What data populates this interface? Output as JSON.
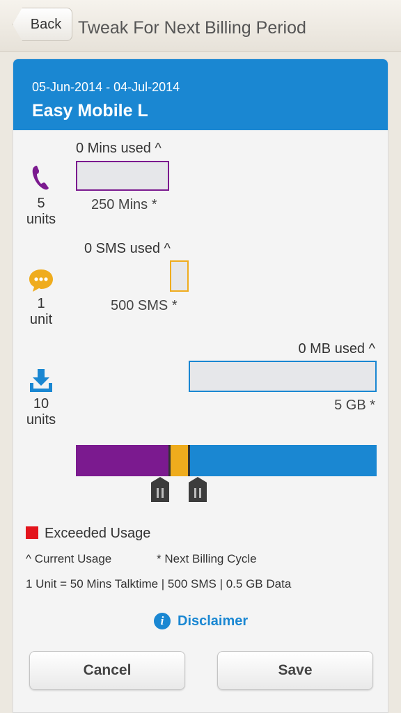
{
  "header": {
    "back_label": "Back",
    "title": "Tweak For Next Billing Period"
  },
  "plan": {
    "period": "05-Jun-2014 - 04-Jul-2014",
    "name": "Easy Mobile L"
  },
  "services": [
    {
      "icon": "phone-icon",
      "color": "#7b1a8f",
      "units_value": "5",
      "units_label": "units",
      "used": "0 Mins used ^",
      "limit": "250 Mins *"
    },
    {
      "icon": "chat-bubble-icon",
      "color": "#efac1d",
      "units_value": "1",
      "units_label": "unit",
      "used": "0 SMS used ^",
      "limit": "500 SMS *"
    },
    {
      "icon": "download-icon",
      "color": "#1a87d2",
      "units_value": "10",
      "units_label": "units",
      "used": "0 MB used ^",
      "limit": "5 GB *"
    }
  ],
  "allocation_units": {
    "talktime": 5,
    "sms": 1,
    "data": 10
  },
  "legend": {
    "exceeded_label": "Exceeded Usage",
    "exceeded_color": "#e3141c",
    "current_usage_note": "^ Current Usage",
    "next_cycle_note": "* Next Billing Cycle",
    "unit_definition": "1 Unit = 50 Mins Talktime | 500 SMS | 0.5 GB Data"
  },
  "disclaimer_label": "Disclaimer",
  "buttons": {
    "cancel": "Cancel",
    "save": "Save"
  },
  "colors": {
    "accent": "#1a87d2",
    "talktime": "#7b1a8f",
    "sms": "#efac1d",
    "data": "#1a87d2"
  }
}
